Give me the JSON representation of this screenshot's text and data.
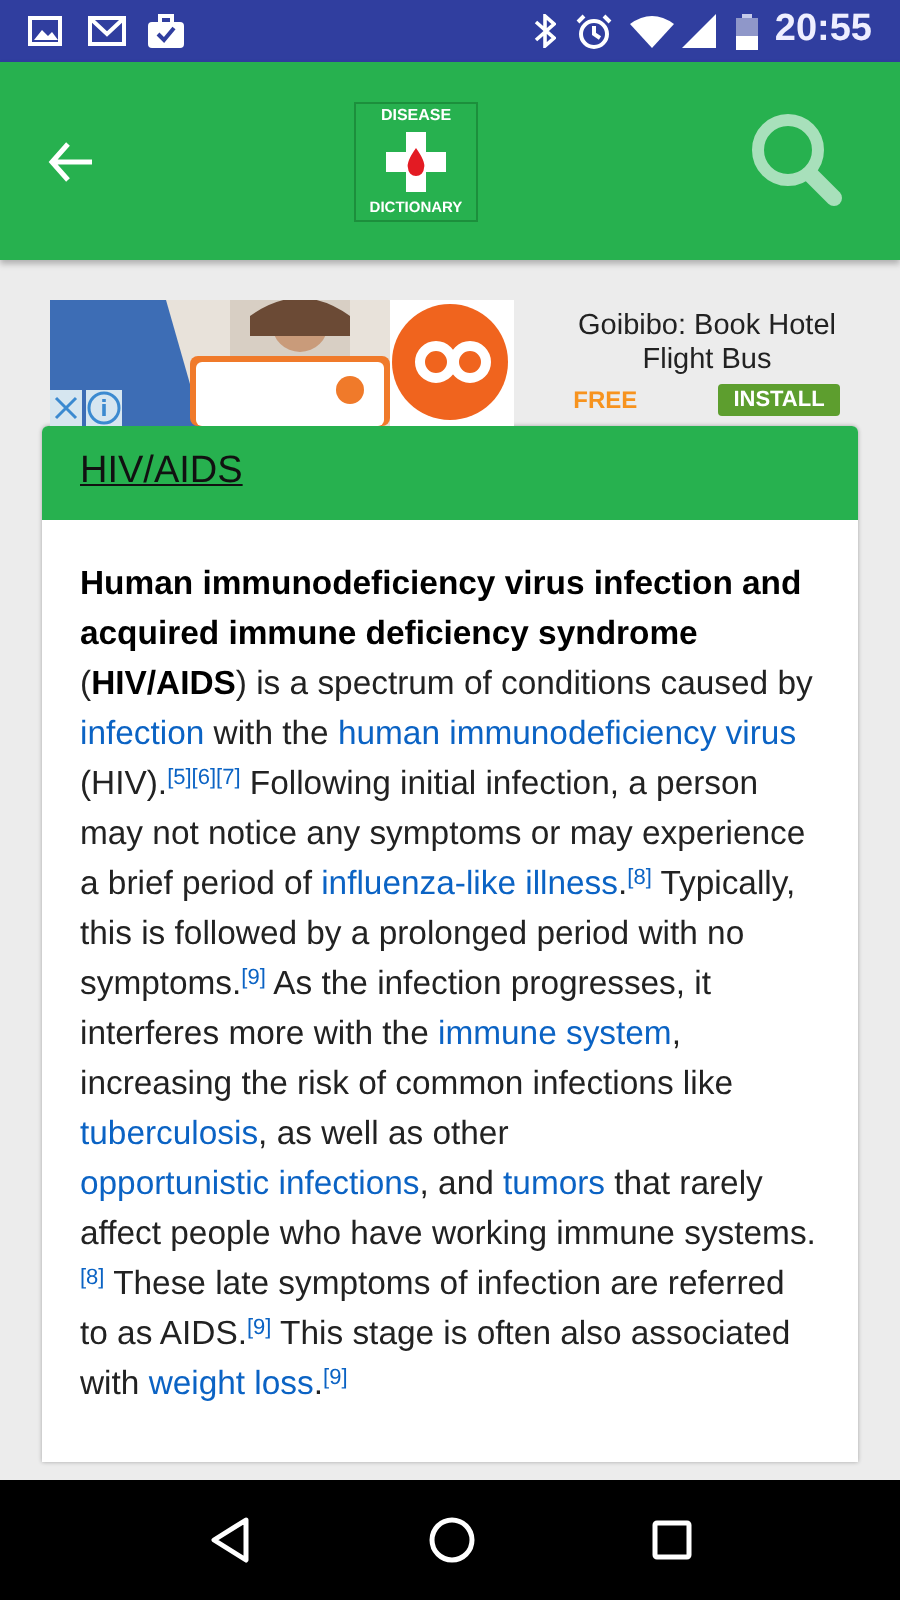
{
  "status_bar": {
    "time": "20:55"
  },
  "header": {
    "logo_top": "DISEASE",
    "logo_bottom": "DICTIONARY"
  },
  "ad": {
    "title": "Goibibo: Book Hotel Flight Bus",
    "price": "FREE",
    "button": "INSTALL"
  },
  "article": {
    "title": "HIV/AIDS",
    "segments": [
      {
        "kind": "bold",
        "text": "Human immunodeficiency virus infection and acquired immune deficiency syndrome"
      },
      {
        "kind": "text",
        "text": " ("
      },
      {
        "kind": "bold",
        "text": "HIV/AIDS"
      },
      {
        "kind": "text",
        "text": ") is a spectrum of conditions caused by "
      },
      {
        "kind": "link",
        "text": "infection"
      },
      {
        "kind": "text",
        "text": " with the "
      },
      {
        "kind": "link",
        "text": "human immunodeficiency virus"
      },
      {
        "kind": "text",
        "text": " (HIV)."
      },
      {
        "kind": "ref",
        "text": "[5][6][7]"
      },
      {
        "kind": "text",
        "text": " Following initial infection, a person may not notice any symptoms or may experience a brief period of "
      },
      {
        "kind": "link",
        "text": "influenza-like illness"
      },
      {
        "kind": "text",
        "text": "."
      },
      {
        "kind": "ref",
        "text": "[8]"
      },
      {
        "kind": "text",
        "text": " Typically, this is followed by a prolonged period with no symptoms."
      },
      {
        "kind": "ref",
        "text": "[9]"
      },
      {
        "kind": "text",
        "text": " As the infection progresses, it interferes more with the "
      },
      {
        "kind": "link",
        "text": "immune system"
      },
      {
        "kind": "text",
        "text": ", increasing the risk of common infections like "
      },
      {
        "kind": "link",
        "text": "tuberculosis"
      },
      {
        "kind": "text",
        "text": ", as well as other "
      },
      {
        "kind": "link",
        "text": "opportunistic infections"
      },
      {
        "kind": "text",
        "text": ", and "
      },
      {
        "kind": "link",
        "text": "tumors"
      },
      {
        "kind": "text",
        "text": " that rarely affect people who have working immune systems."
      },
      {
        "kind": "ref",
        "text": "[8]"
      },
      {
        "kind": "text",
        "text": " These late symptoms of infection are referred to as AIDS."
      },
      {
        "kind": "ref",
        "text": "[9]"
      },
      {
        "kind": "text",
        "text": " This stage is often also associated with "
      },
      {
        "kind": "link",
        "text": "weight loss"
      },
      {
        "kind": "text",
        "text": "."
      },
      {
        "kind": "ref",
        "text": "[9]"
      }
    ]
  }
}
